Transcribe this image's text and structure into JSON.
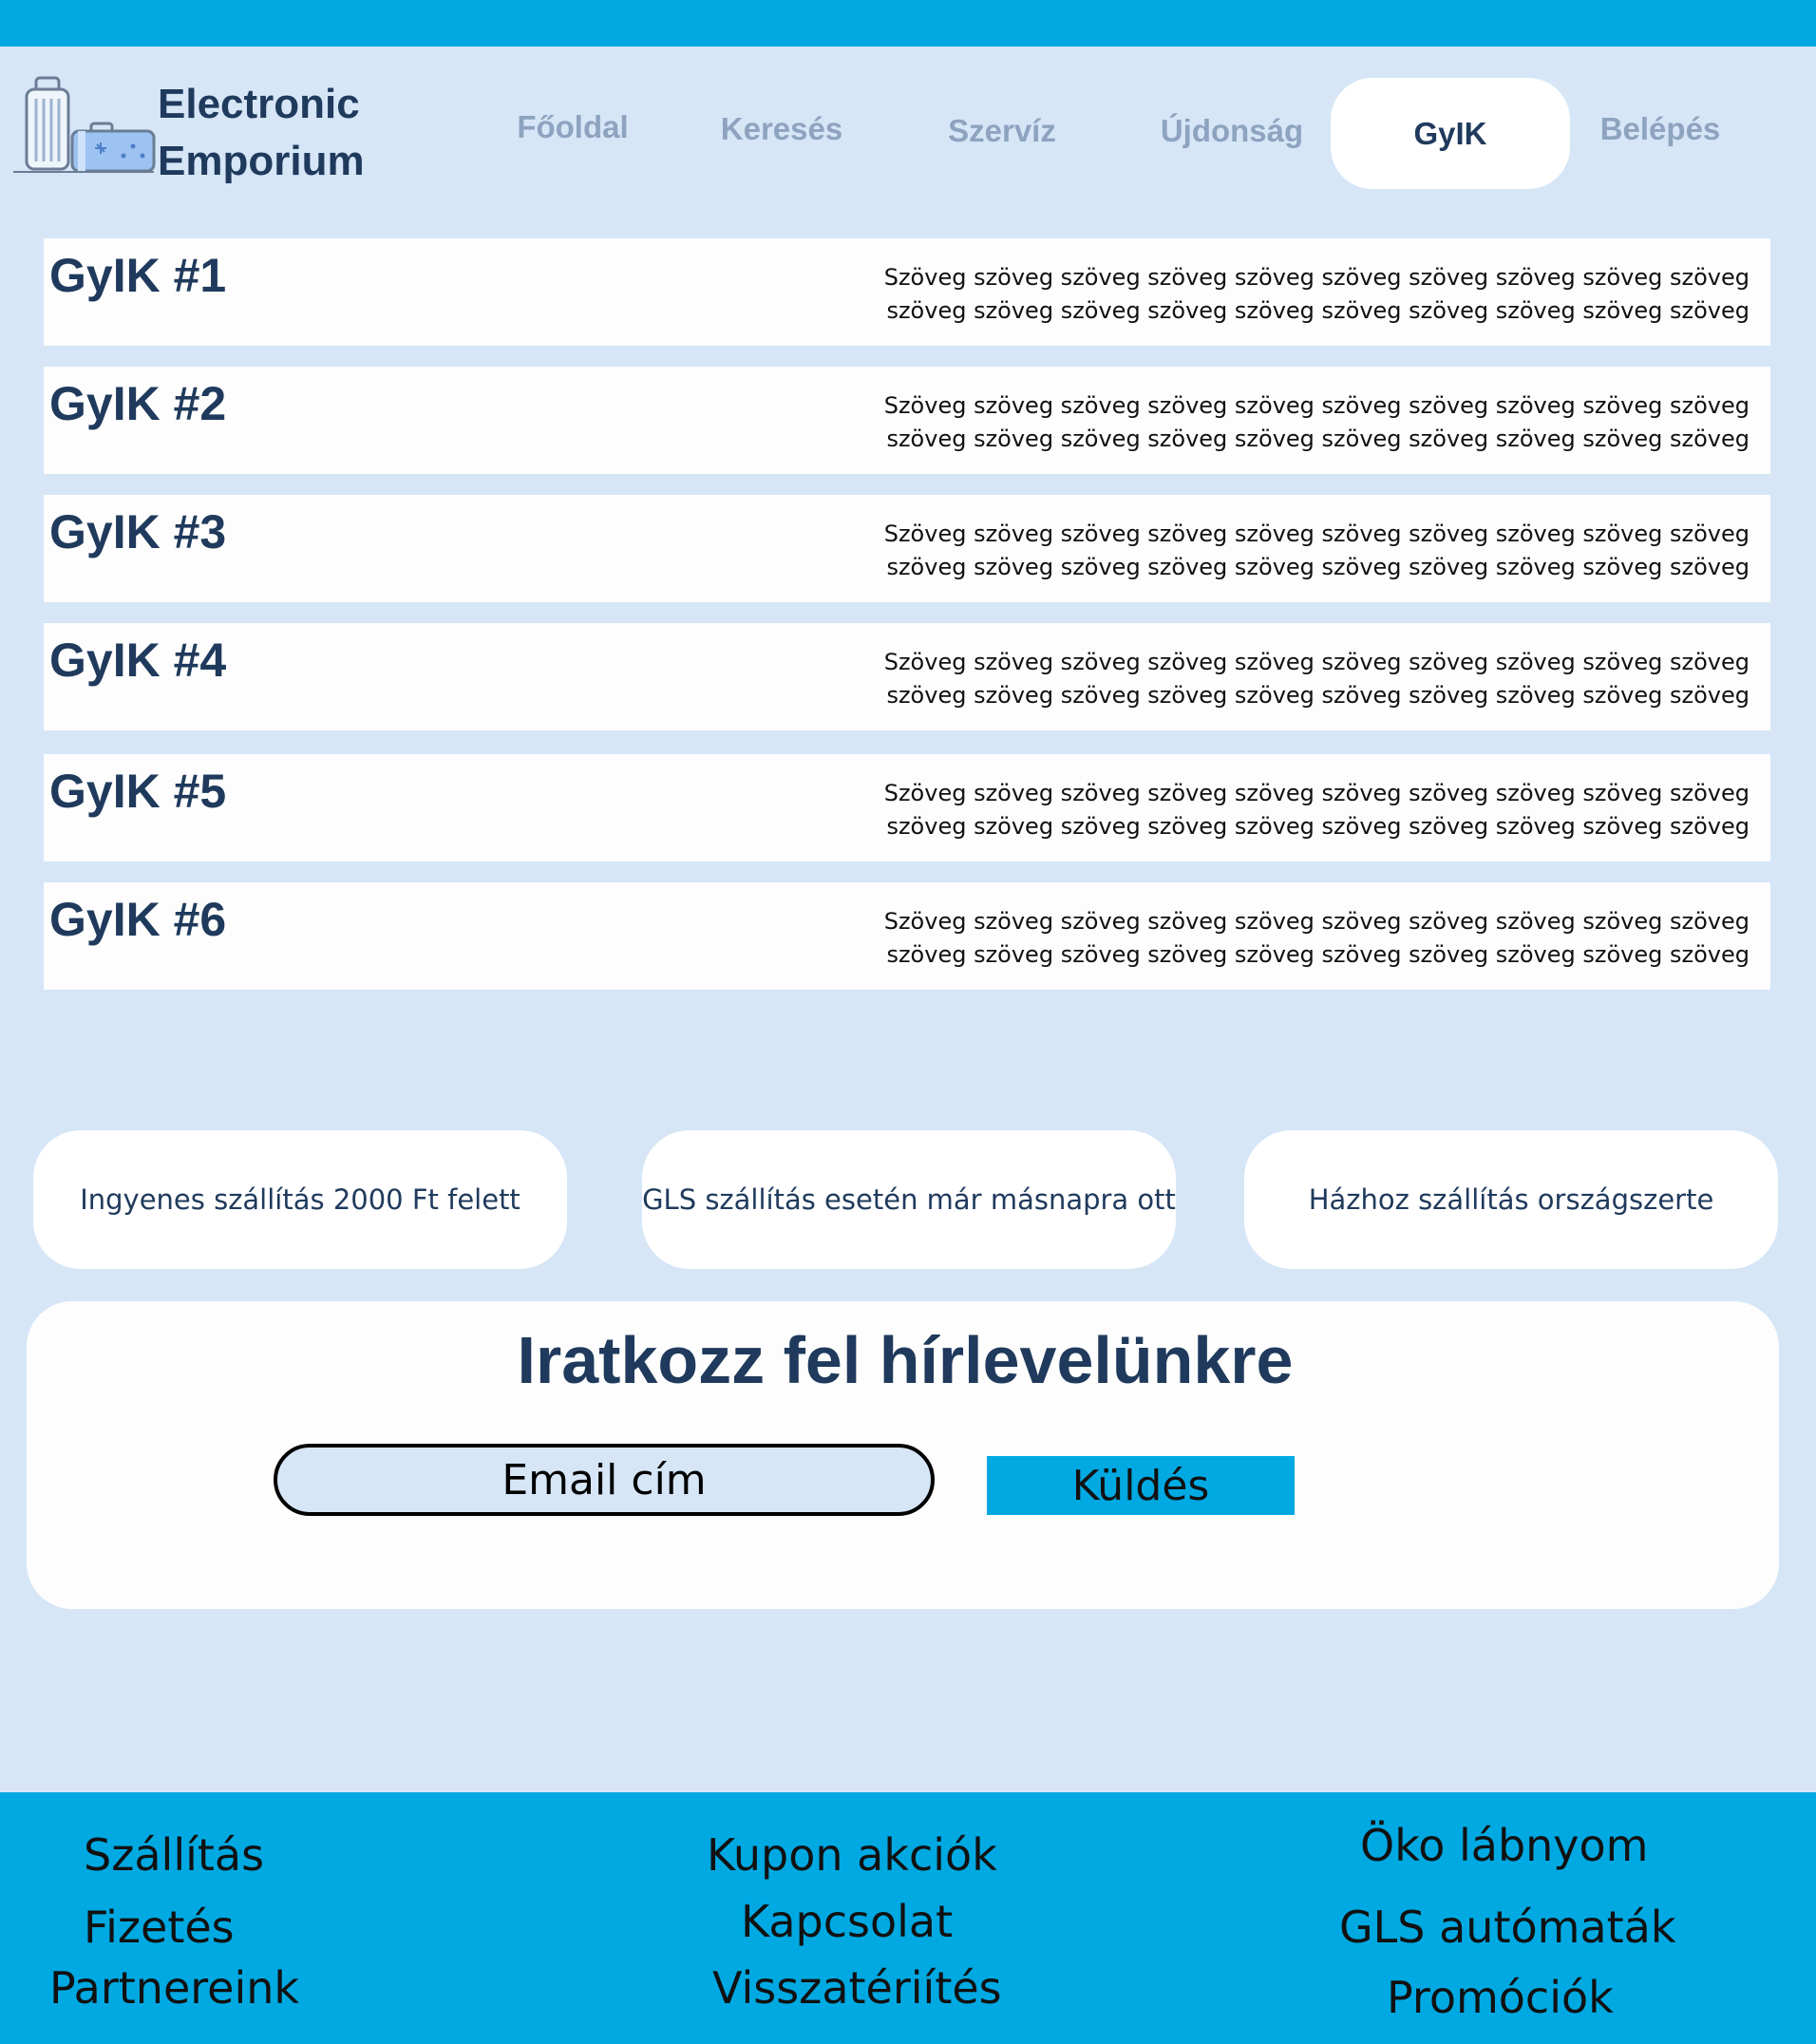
{
  "brand": {
    "name_line1": "Electronic",
    "name_line2": "Emporium",
    "logo_icon": "luggage-icon"
  },
  "nav": {
    "items": [
      {
        "label": "Főoldal",
        "active": false
      },
      {
        "label": "Keresés",
        "active": false
      },
      {
        "label": "Szervíz",
        "active": false
      },
      {
        "label": "Újdonság",
        "active": false
      },
      {
        "label": "GyIK",
        "active": true
      },
      {
        "label": "Belépés",
        "active": false
      }
    ]
  },
  "faq": {
    "items": [
      {
        "title": "GyIK #1",
        "text": "Szöveg szöveg szöveg szöveg szöveg szöveg szöveg szöveg szöveg szöveg szöveg szöveg szöveg szöveg szöveg szöveg szöveg szöveg szöveg szöveg"
      },
      {
        "title": "GyIK #2",
        "text": "Szöveg szöveg szöveg szöveg szöveg szöveg szöveg szöveg szöveg szöveg szöveg szöveg szöveg szöveg szöveg szöveg szöveg szöveg szöveg szöveg"
      },
      {
        "title": "GyIK #3",
        "text": "Szöveg szöveg szöveg szöveg szöveg szöveg szöveg szöveg szöveg szöveg szöveg szöveg szöveg szöveg szöveg szöveg szöveg szöveg szöveg szöveg"
      },
      {
        "title": "GyIK #4",
        "text": "Szöveg szöveg szöveg szöveg szöveg szöveg szöveg szöveg szöveg szöveg szöveg szöveg szöveg szöveg szöveg szöveg szöveg szöveg szöveg szöveg"
      },
      {
        "title": "GyIK #5",
        "text": "Szöveg szöveg szöveg szöveg szöveg szöveg szöveg szöveg szöveg szöveg szöveg szöveg szöveg szöveg szöveg szöveg szöveg szöveg szöveg szöveg"
      },
      {
        "title": "GyIK #6",
        "text": "Szöveg szöveg szöveg szöveg szöveg szöveg szöveg szöveg szöveg szöveg szöveg szöveg szöveg szöveg szöveg szöveg szöveg szöveg szöveg szöveg"
      }
    ]
  },
  "info_cards": [
    "Ingyenes szállítás 2000 Ft felett",
    "GLS szállítás esetén már másnapra ott",
    "Házhoz szállítás országszerte"
  ],
  "newsletter": {
    "title": "Iratkozz fel hírlevelünkre",
    "email_placeholder": "Email cím",
    "send_label": "Küldés"
  },
  "footer": {
    "col1": [
      "Szállítás",
      "Fizetés",
      "Partnereink"
    ],
    "col2": [
      "Kupon akciók",
      "Kapcsolat",
      "Visszatériítés"
    ],
    "col3": [
      "Öko lábnyom",
      "GLS autómaták",
      "Promóciók"
    ]
  },
  "colors": {
    "accent": "#00a9e2",
    "background": "#d6e6f7",
    "card": "#ffffff",
    "text_dark": "#1f3a5c",
    "nav_inactive": "#8ea3bf"
  }
}
